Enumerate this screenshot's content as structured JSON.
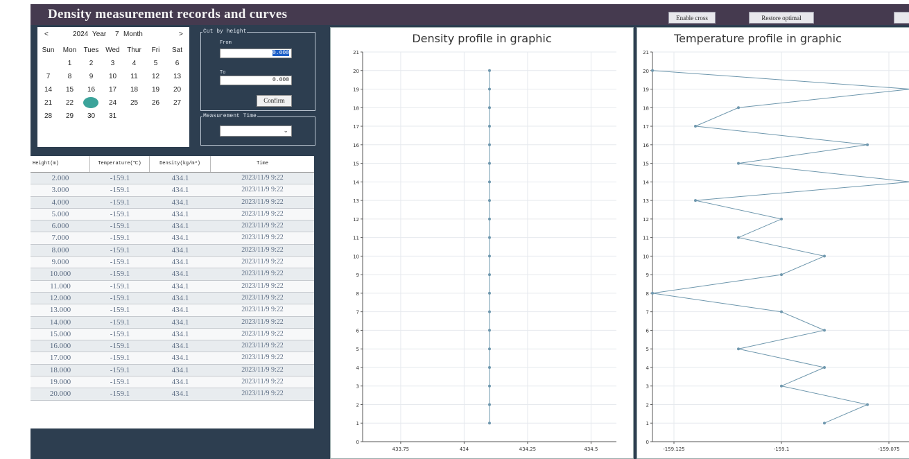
{
  "window": {
    "title": "Density measurement records and curves",
    "enable_cross": "Enable cross",
    "restore_optimal": "Restore optimal"
  },
  "calendar": {
    "prev": "<",
    "next": ">",
    "year": "2024",
    "year_label": "Year",
    "month": "7",
    "month_label": "Month",
    "weekdays": [
      "Sun",
      "Mon",
      "Tues",
      "Wed",
      "Thur",
      "Fri",
      "Sat"
    ],
    "weeks": [
      [
        "",
        "1",
        "2",
        "3",
        "4",
        "5",
        "6"
      ],
      [
        "7",
        "8",
        "9",
        "10",
        "11",
        "12",
        "13"
      ],
      [
        "14",
        "15",
        "16",
        "17",
        "18",
        "19",
        "20"
      ],
      [
        "21",
        "22",
        "23",
        "24",
        "25",
        "26",
        "27"
      ],
      [
        "28",
        "29",
        "30",
        "31",
        "",
        "",
        ""
      ]
    ],
    "selected_day": "23"
  },
  "cut_by_height": {
    "legend": "Cut by height",
    "from_label": "From",
    "from_value": "0.000",
    "to_label": "To",
    "to_value": "0.000",
    "confirm": "Confirm"
  },
  "measurement_time": {
    "legend": "Measurement Time",
    "value": ""
  },
  "table": {
    "headers": [
      "Height(m)",
      "Temperature(℃)",
      "Density(kg/m³)",
      "Time"
    ],
    "rows": [
      [
        "2.000",
        "-159.1",
        "434.1",
        "2023/11/9 9:22"
      ],
      [
        "3.000",
        "-159.1",
        "434.1",
        "2023/11/9 9:22"
      ],
      [
        "4.000",
        "-159.1",
        "434.1",
        "2023/11/9 9:22"
      ],
      [
        "5.000",
        "-159.1",
        "434.1",
        "2023/11/9 9:22"
      ],
      [
        "6.000",
        "-159.1",
        "434.1",
        "2023/11/9 9:22"
      ],
      [
        "7.000",
        "-159.1",
        "434.1",
        "2023/11/9 9:22"
      ],
      [
        "8.000",
        "-159.1",
        "434.1",
        "2023/11/9 9:22"
      ],
      [
        "9.000",
        "-159.1",
        "434.1",
        "2023/11/9 9:22"
      ],
      [
        "10.000",
        "-159.1",
        "434.1",
        "2023/11/9 9:22"
      ],
      [
        "11.000",
        "-159.1",
        "434.1",
        "2023/11/9 9:22"
      ],
      [
        "12.000",
        "-159.1",
        "434.1",
        "2023/11/9 9:22"
      ],
      [
        "13.000",
        "-159.1",
        "434.1",
        "2023/11/9 9:22"
      ],
      [
        "14.000",
        "-159.1",
        "434.1",
        "2023/11/9 9:22"
      ],
      [
        "15.000",
        "-159.1",
        "434.1",
        "2023/11/9 9:22"
      ],
      [
        "16.000",
        "-159.1",
        "434.1",
        "2023/11/9 9:22"
      ],
      [
        "17.000",
        "-159.1",
        "434.1",
        "2023/11/9 9:22"
      ],
      [
        "18.000",
        "-159.1",
        "434.1",
        "2023/11/9 9:22"
      ],
      [
        "19.000",
        "-159.1",
        "434.1",
        "2023/11/9 9:22"
      ],
      [
        "20.000",
        "-159.1",
        "434.1",
        "2023/11/9 9:22"
      ]
    ]
  },
  "colors": {
    "panel_bg": "#2d3e50",
    "title_bar": "#453a4f",
    "series": "#6e97ad",
    "selected_day": "#3ba39a"
  },
  "chart_data": [
    {
      "type": "line",
      "title": "Density profile in graphic",
      "xlabel": "",
      "ylabel": "",
      "x_ticks": [
        433.75,
        434,
        434.25,
        434.5
      ],
      "y_ticks": [
        0,
        1,
        2,
        3,
        4,
        5,
        6,
        7,
        8,
        9,
        10,
        11,
        12,
        13,
        14,
        15,
        16,
        17,
        18,
        19,
        20,
        21
      ],
      "xlim": [
        433.6,
        434.6
      ],
      "ylim": [
        0,
        21
      ],
      "grid": true,
      "series": [
        {
          "x": [
            434.1,
            434.1,
            434.1,
            434.1,
            434.1,
            434.1,
            434.1,
            434.1,
            434.1,
            434.1,
            434.1,
            434.1,
            434.1,
            434.1,
            434.1,
            434.1,
            434.1,
            434.1,
            434.1,
            434.1
          ],
          "y": [
            1,
            2,
            3,
            4,
            5,
            6,
            7,
            8,
            9,
            10,
            11,
            12,
            13,
            14,
            15,
            16,
            17,
            18,
            19,
            20
          ]
        }
      ]
    },
    {
      "type": "line",
      "title": "Temperature profile in graphic",
      "xlabel": "",
      "ylabel": "",
      "x_ticks": [
        -159.125,
        -159.1,
        -159.075
      ],
      "y_ticks": [
        0,
        1,
        2,
        3,
        4,
        5,
        6,
        7,
        8,
        9,
        10,
        11,
        12,
        13,
        14,
        15,
        16,
        17,
        18,
        19,
        20,
        21
      ],
      "xlim": [
        -159.13,
        -159.07
      ],
      "ylim": [
        0,
        21
      ],
      "grid": true,
      "series": [
        {
          "x": [
            -159.09,
            -159.08,
            -159.1,
            -159.09,
            -159.11,
            -159.09,
            -159.1,
            -159.13,
            -159.1,
            -159.09,
            -159.11,
            -159.1,
            -159.12,
            -159.07,
            -159.11,
            -159.08,
            -159.12,
            -159.11,
            -159.07,
            -159.13
          ],
          "y": [
            1,
            2,
            3,
            4,
            5,
            6,
            7,
            8,
            9,
            10,
            11,
            12,
            13,
            14,
            15,
            16,
            17,
            18,
            19,
            20
          ]
        }
      ]
    }
  ]
}
